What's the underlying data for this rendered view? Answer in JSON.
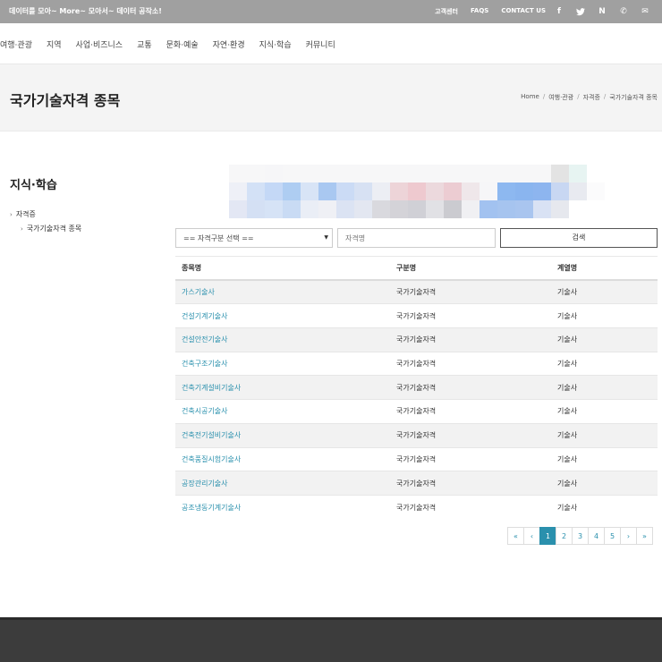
{
  "topbar": {
    "tagline": "데이터를 모아~ More~ 모아서~ 데이터 공작소!",
    "links": [
      "고객센터",
      "FAQS",
      "CONTACT US"
    ],
    "icons": [
      {
        "name": "facebook-icon",
        "glyph": "f"
      },
      {
        "name": "twitter-icon",
        "glyph": "🐦"
      },
      {
        "name": "naver-icon",
        "glyph": "N"
      },
      {
        "name": "phone-icon",
        "glyph": "✆"
      },
      {
        "name": "mail-icon",
        "glyph": "✉"
      }
    ],
    "bg_color": "#a0a0a0"
  },
  "nav": {
    "items": [
      "여행·관광",
      "지역",
      "사업·비즈니스",
      "교통",
      "문화·예술",
      "자연·환경",
      "지식·학습",
      "커뮤니티"
    ]
  },
  "page_header": {
    "title": "국가기술자격 종목",
    "breadcrumb": [
      "Home",
      "여행·관광",
      "자격증",
      "국가기술자격 종목"
    ]
  },
  "sidebar": {
    "title": "지식·학습",
    "items": [
      {
        "label": "자격증"
      },
      {
        "label": "국가기술자격 종목"
      }
    ]
  },
  "search": {
    "select_value": "== 자격구분 선택 ==",
    "input_placeholder": "자격명",
    "button_label": "검색"
  },
  "table": {
    "headers": [
      "종목명",
      "구분명",
      "계열명"
    ],
    "rows": [
      [
        "가스기술사",
        "국가기술자격",
        "기술사"
      ],
      [
        "건설기계기술사",
        "국가기술자격",
        "기술사"
      ],
      [
        "건설안전기술사",
        "국가기술자격",
        "기술사"
      ],
      [
        "건축구조기술사",
        "국가기술자격",
        "기술사"
      ],
      [
        "건축기계설비기술사",
        "국가기술자격",
        "기술사"
      ],
      [
        "건축시공기술사",
        "국가기술자격",
        "기술사"
      ],
      [
        "건축전기설비기술사",
        "국가기술자격",
        "기술사"
      ],
      [
        "건축품질시험기술사",
        "국가기술자격",
        "기술사"
      ],
      [
        "공장관리기술사",
        "국가기술자격",
        "기술사"
      ],
      [
        "공조냉동기계기술사",
        "국가기술자격",
        "기술사"
      ]
    ]
  },
  "pagination": {
    "first": "«",
    "prev": "‹",
    "pages": [
      "1",
      "2",
      "3",
      "4",
      "5"
    ],
    "current": "1",
    "next": "›",
    "last": "»"
  },
  "colors": {
    "accent": "#2a90ad",
    "footer": "#3c3c3c"
  }
}
